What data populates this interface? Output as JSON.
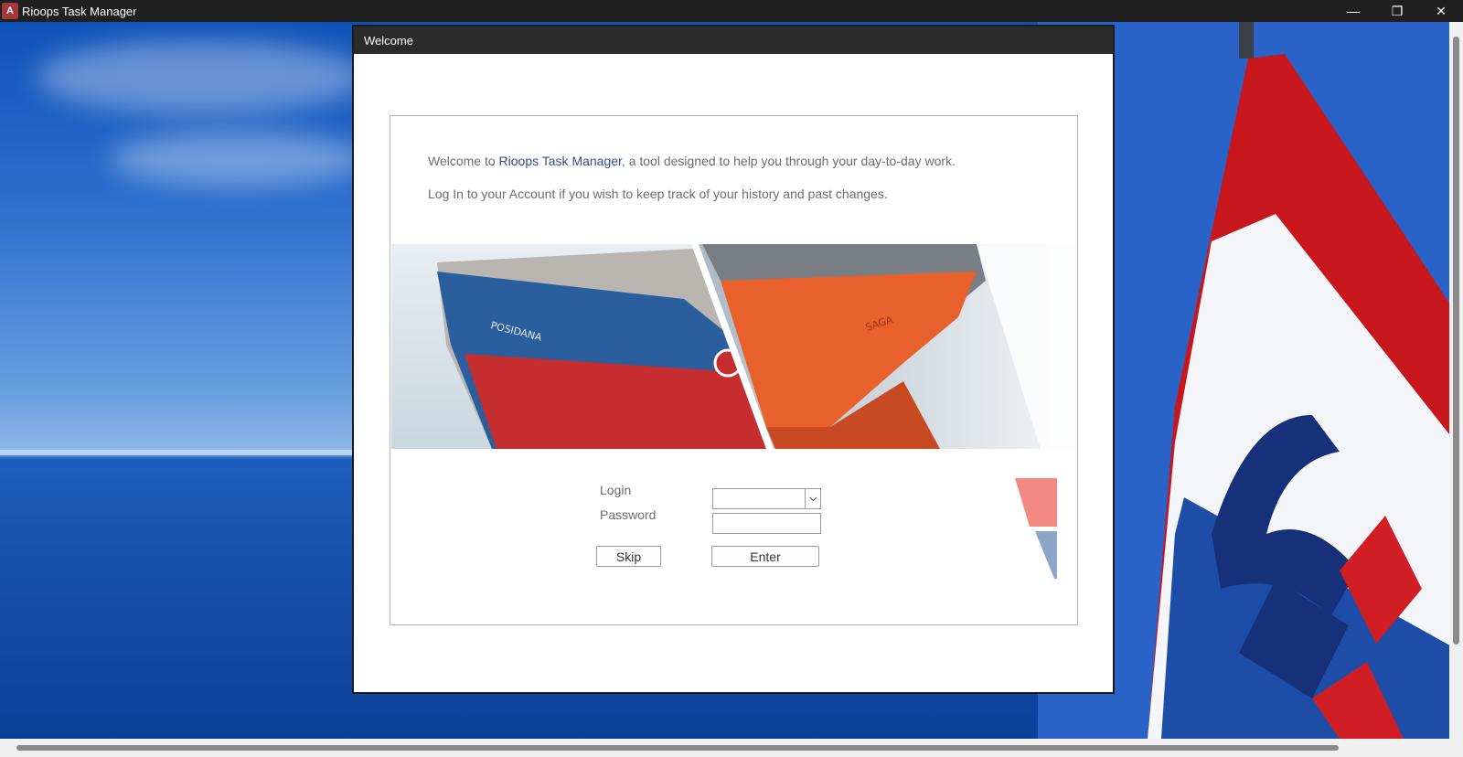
{
  "app": {
    "logo_letter": "A",
    "title": "Rioops Task Manager"
  },
  "window_controls": {
    "minimize": "—",
    "restore": "❐",
    "close": "✕"
  },
  "dialog": {
    "title": "Welcome",
    "intro": {
      "prefix": "Welcome to ",
      "brand": "Rioops Task Manager",
      "suffix": ", a tool designed to help you through your day-to-day work.",
      "line2": "Log In to your Account if you wish to keep track of your history and past changes."
    },
    "banner": {
      "left_ship_name": "POSIDANA",
      "right_ship_name": "SAGA"
    },
    "form": {
      "login_label": "Login",
      "login_value": "",
      "password_label": "Password",
      "password_value": "",
      "skip_label": "Skip",
      "enter_label": "Enter"
    }
  },
  "colors": {
    "title_bar": "#202020",
    "brand_text": "#2c4f8a",
    "deco_red": "#f28a83",
    "deco_blue": "#8ba6c8"
  }
}
